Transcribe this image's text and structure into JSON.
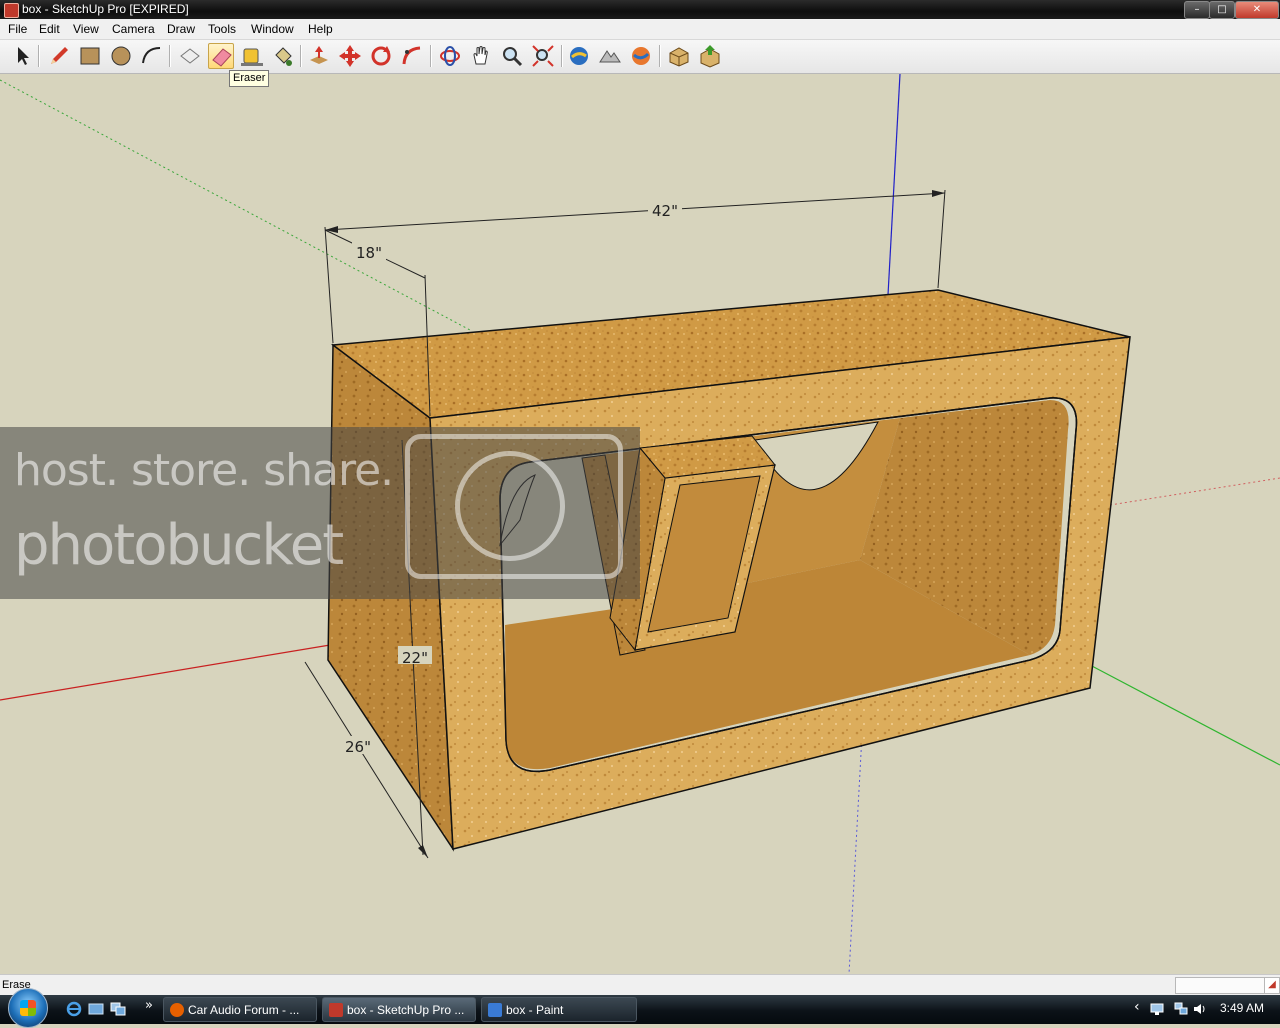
{
  "window": {
    "title": "box - SketchUp Pro [EXPIRED]",
    "controls": {
      "minimize": "–",
      "maximize": "□",
      "close": "✕"
    }
  },
  "menu": [
    "File",
    "Edit",
    "View",
    "Camera",
    "Draw",
    "Tools",
    "Window",
    "Help"
  ],
  "toolbar": {
    "tools": [
      {
        "name": "select",
        "icon": "arrow-select-icon"
      },
      {
        "name": "pencil",
        "icon": "pencil-icon"
      },
      {
        "name": "rectangle",
        "icon": "rectangle-icon"
      },
      {
        "name": "circle",
        "icon": "circle-icon"
      },
      {
        "name": "arc",
        "icon": "arc-icon"
      },
      {
        "name": "make-component",
        "icon": "component-icon"
      },
      {
        "name": "eraser",
        "icon": "eraser-icon",
        "active": true
      },
      {
        "name": "tape-measure",
        "icon": "tape-measure-icon"
      },
      {
        "name": "paint-bucket",
        "icon": "paint-bucket-icon"
      },
      {
        "name": "push-pull",
        "icon": "push-pull-icon"
      },
      {
        "name": "move",
        "icon": "move-icon"
      },
      {
        "name": "rotate",
        "icon": "rotate-icon"
      },
      {
        "name": "follow-me",
        "icon": "follow-me-icon"
      },
      {
        "name": "orbit",
        "icon": "orbit-icon"
      },
      {
        "name": "pan",
        "icon": "pan-hand-icon"
      },
      {
        "name": "zoom",
        "icon": "zoom-icon"
      },
      {
        "name": "zoom-extents",
        "icon": "zoom-extents-icon"
      },
      {
        "name": "get-current-view",
        "icon": "google-earth-icon"
      },
      {
        "name": "toggle-terrain",
        "icon": "terrain-icon"
      },
      {
        "name": "place-model",
        "icon": "place-model-icon"
      },
      {
        "name": "get-models",
        "icon": "get-models-icon"
      },
      {
        "name": "share-model",
        "icon": "share-model-icon"
      }
    ],
    "tooltip": "Eraser"
  },
  "model": {
    "dimensions": {
      "width": "42\"",
      "depth_top": "18\"",
      "height": "22\"",
      "depth_side": "26\""
    },
    "colors": {
      "wood": "#c9923d",
      "wood_light": "#dba956",
      "wood_dark": "#a8742c",
      "edge": "#1a1a1a",
      "sky": "#d7d4bd"
    }
  },
  "watermark": {
    "line1": "host. store. share.",
    "line2": "photobucket"
  },
  "status": {
    "text": "Erase"
  },
  "taskbar": {
    "items": [
      {
        "label": "Car Audio Forum - ...",
        "icon": "firefox-icon",
        "color": "#e66000"
      },
      {
        "label": "box - SketchUp Pro ...",
        "icon": "sketchup-icon",
        "color": "#c0392b",
        "active": true
      },
      {
        "label": "box - Paint",
        "icon": "paint-icon",
        "color": "#3a7bd5"
      }
    ],
    "clock": "3:49 AM",
    "show_desktop_chevron": "»",
    "tray_chevron": "‹"
  }
}
